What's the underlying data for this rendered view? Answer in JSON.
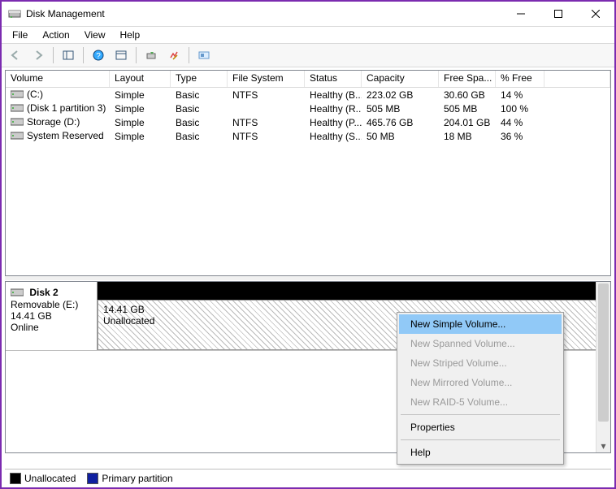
{
  "window": {
    "title": "Disk Management"
  },
  "menu": {
    "file": "File",
    "action": "Action",
    "view": "View",
    "help": "Help"
  },
  "columns": {
    "volume": "Volume",
    "layout": "Layout",
    "type": "Type",
    "filesystem": "File System",
    "status": "Status",
    "capacity": "Capacity",
    "freespace": "Free Spa...",
    "pctfree": "% Free"
  },
  "volumes": [
    {
      "name": "(C:)",
      "layout": "Simple",
      "type": "Basic",
      "fs": "NTFS",
      "status": "Healthy (B...",
      "capacity": "223.02 GB",
      "free": "30.60 GB",
      "pct": "14 %"
    },
    {
      "name": "(Disk 1 partition 3)",
      "layout": "Simple",
      "type": "Basic",
      "fs": "",
      "status": "Healthy (R...",
      "capacity": "505 MB",
      "free": "505 MB",
      "pct": "100 %"
    },
    {
      "name": "Storage (D:)",
      "layout": "Simple",
      "type": "Basic",
      "fs": "NTFS",
      "status": "Healthy (P...",
      "capacity": "465.76 GB",
      "free": "204.01 GB",
      "pct": "44 %"
    },
    {
      "name": "System Reserved",
      "layout": "Simple",
      "type": "Basic",
      "fs": "NTFS",
      "status": "Healthy (S...",
      "capacity": "50 MB",
      "free": "18 MB",
      "pct": "36 %"
    }
  ],
  "disk": {
    "title": "Disk 2",
    "line1": "Removable (E:)",
    "line2": "14.41 GB",
    "line3": "Online",
    "part_size": "14.41 GB",
    "part_label": "Unallocated"
  },
  "legend": {
    "unallocated": "Unallocated",
    "primary": "Primary partition"
  },
  "context": {
    "new_simple": "New Simple Volume...",
    "new_spanned": "New Spanned Volume...",
    "new_striped": "New Striped Volume...",
    "new_mirrored": "New Mirrored Volume...",
    "new_raid5": "New RAID-5 Volume...",
    "properties": "Properties",
    "help": "Help"
  },
  "colors": {
    "primary_partition": "#1020a0",
    "unallocated": "#000000"
  }
}
